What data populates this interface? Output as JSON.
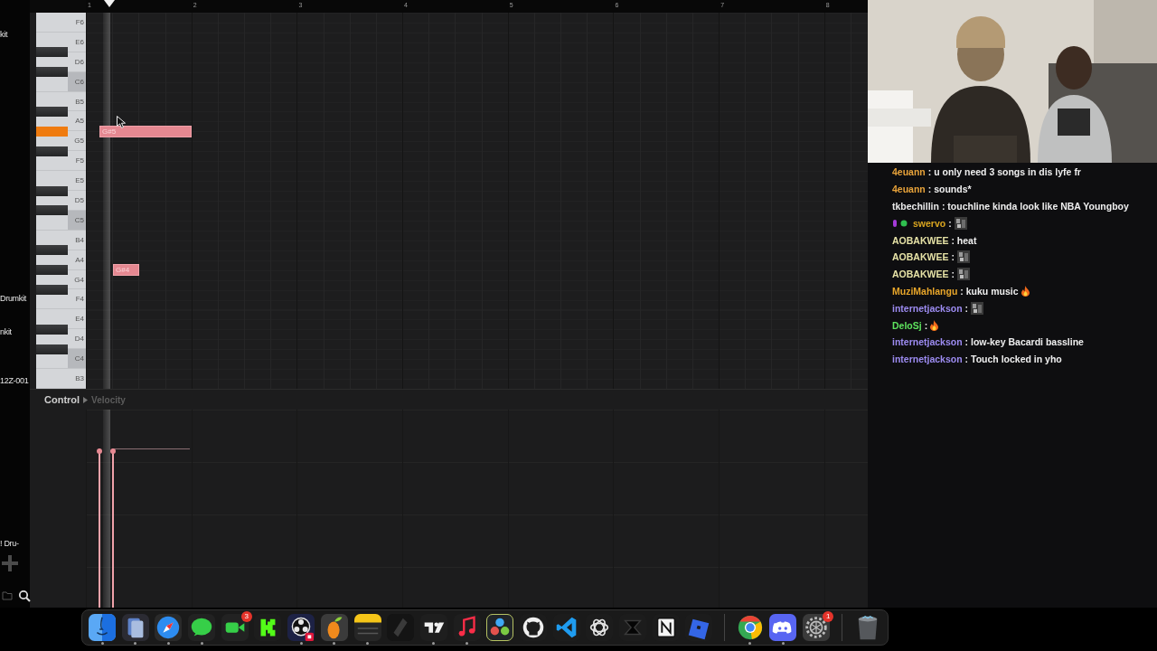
{
  "sidebar": {
    "items": [
      {
        "text": "kit"
      },
      {
        "text": "Drumkit"
      },
      {
        "text": "nkit"
      },
      {
        "text": "12Z-001"
      },
      {
        "text": "! Dru-"
      }
    ]
  },
  "ruler": {
    "bars": [
      "1",
      "2",
      "3",
      "4",
      "5",
      "6",
      "7",
      "8"
    ]
  },
  "piano": {
    "keys": [
      {
        "label": "F6",
        "sharp": false,
        "octave_start": false
      },
      {
        "label": "E6",
        "sharp": false,
        "octave_start": false
      },
      {
        "label": "D6",
        "sharp": true,
        "sharp_pressed": false,
        "octave_start": false
      },
      {
        "label": "C6",
        "sharp": true,
        "sharp_pressed": false,
        "octave_start": true
      },
      {
        "label": "B5",
        "sharp": false,
        "octave_start": false
      },
      {
        "label": "A5",
        "sharp": true,
        "sharp_pressed": false,
        "octave_start": false
      },
      {
        "label": "G5",
        "sharp": true,
        "sharp_pressed": true,
        "octave_start": false
      },
      {
        "label": "F5",
        "sharp": true,
        "sharp_pressed": false,
        "octave_start": false
      },
      {
        "label": "E5",
        "sharp": false,
        "octave_start": false
      },
      {
        "label": "D5",
        "sharp": true,
        "sharp_pressed": false,
        "octave_start": false
      },
      {
        "label": "C5",
        "sharp": true,
        "sharp_pressed": false,
        "octave_start": true
      },
      {
        "label": "B4",
        "sharp": false,
        "octave_start": false
      },
      {
        "label": "A4",
        "sharp": true,
        "sharp_pressed": false,
        "octave_start": false
      },
      {
        "label": "G4",
        "sharp": true,
        "sharp_pressed": false,
        "octave_start": false
      },
      {
        "label": "F4",
        "sharp": true,
        "sharp_pressed": false,
        "octave_start": false
      },
      {
        "label": "E4",
        "sharp": false,
        "octave_start": false
      },
      {
        "label": "D4",
        "sharp": true,
        "sharp_pressed": false,
        "octave_start": false
      },
      {
        "label": "C4",
        "sharp": true,
        "sharp_pressed": false,
        "octave_start": true
      },
      {
        "label": "B3",
        "sharp": false,
        "octave_start": false
      }
    ]
  },
  "notes": [
    {
      "label": "G#5",
      "level": 0.8
    },
    {
      "label": "G#4",
      "level": 0.8
    }
  ],
  "control": {
    "label": "Control",
    "parameter": "Velocity"
  },
  "chat": {
    "messages": [
      {
        "user": "4euann",
        "color": "#e8a33a",
        "text": ": u only need 3 songs in dis lyfe fr",
        "kind": "text"
      },
      {
        "user": "4euann",
        "color": "#e8a33a",
        "text": ": sounds*",
        "kind": "text"
      },
      {
        "user": "tkbechillin",
        "color": "#ececec",
        "text": ": touchline kinda look like NBA Youngboy",
        "kind": "text"
      },
      {
        "user": "swervo",
        "color": "#d9a520",
        "text": ":",
        "badges": true,
        "kind": "emote"
      },
      {
        "user": "AOBAKWEE",
        "color": "#e6e2a6",
        "text": ": heat",
        "kind": "text"
      },
      {
        "user": "AOBAKWEE",
        "color": "#e6e2a6",
        "text": ":",
        "kind": "emote"
      },
      {
        "user": "AOBAKWEE",
        "color": "#e6e2a6",
        "text": ":",
        "kind": "emote"
      },
      {
        "user": "MuziMahlangu",
        "color": "#e8a62a",
        "text": ": kuku music",
        "kind": "fire"
      },
      {
        "user": "internetjackson",
        "color": "#9d8cf2",
        "text": ":",
        "kind": "emote"
      },
      {
        "user": "DeloSj",
        "color": "#5ee35e",
        "text": ":",
        "kind": "fire"
      },
      {
        "user": "internetjackson",
        "color": "#9d8cf2",
        "text": ": low-key Bacardi bassline",
        "kind": "text"
      },
      {
        "user": "internetjackson",
        "color": "#9d8cf2",
        "text": ": Touch locked in yho",
        "kind": "text"
      }
    ]
  },
  "dock": {
    "items": [
      {
        "kind": "finder",
        "running": true
      },
      {
        "kind": "files",
        "running": true
      },
      {
        "kind": "safari",
        "running": true
      },
      {
        "kind": "messages",
        "running": true
      },
      {
        "kind": "facetime",
        "running": false,
        "badge": "3"
      },
      {
        "kind": "kick",
        "running": false
      },
      {
        "kind": "obs",
        "running": true
      },
      {
        "kind": "fl",
        "running": true
      },
      {
        "kind": "notes",
        "running": true
      },
      {
        "kind": "slash",
        "running": false
      },
      {
        "kind": "tradingview",
        "running": true
      },
      {
        "kind": "music",
        "running": true
      },
      {
        "kind": "davinci",
        "running": false
      },
      {
        "kind": "github",
        "running": false
      },
      {
        "kind": "vscode",
        "running": false
      },
      {
        "kind": "chatgpt",
        "running": false
      },
      {
        "kind": "capcut",
        "running": false
      },
      {
        "kind": "notion",
        "running": false
      },
      {
        "kind": "roblox",
        "running": false
      },
      {
        "kind": "separator"
      },
      {
        "kind": "chrome",
        "running": true
      },
      {
        "kind": "discord",
        "running": true
      },
      {
        "kind": "settings",
        "running": false,
        "badge": "1"
      },
      {
        "kind": "separator"
      },
      {
        "kind": "trash",
        "running": false
      }
    ]
  }
}
